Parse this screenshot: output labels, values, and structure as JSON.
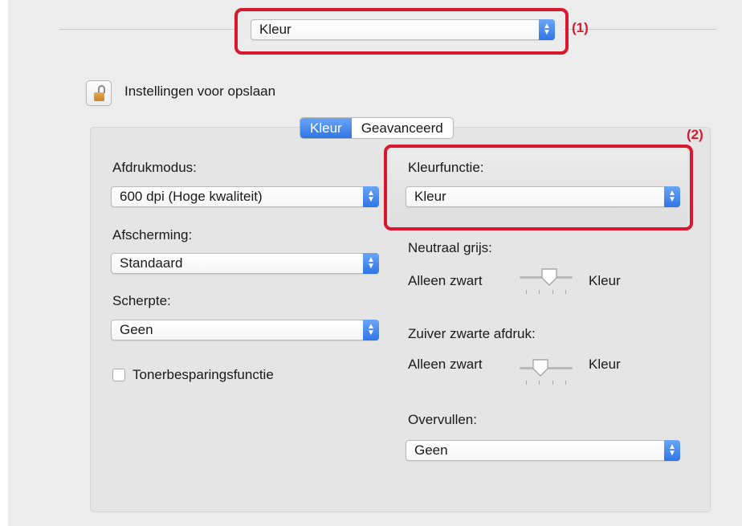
{
  "top_popup": {
    "value": "Kleur"
  },
  "annotations": {
    "one": "(1)",
    "two": "(2)"
  },
  "save_settings": {
    "label": "Instellingen voor opslaan"
  },
  "tabs": [
    {
      "label": "Kleur",
      "active": true
    },
    {
      "label": "Geavanceerd",
      "active": false
    }
  ],
  "left": {
    "print_mode": {
      "label": "Afdrukmodus:",
      "value": "600 dpi (Hoge kwaliteit)"
    },
    "screening": {
      "label": "Afscherming:",
      "value": "Standaard"
    },
    "sharpness": {
      "label": "Scherpte:",
      "value": "Geen"
    },
    "toner_save": {
      "label": "Tonerbesparingsfunctie",
      "checked": false
    }
  },
  "right": {
    "color_mode": {
      "label": "Kleurfunctie:",
      "value": "Kleur"
    },
    "neutral_gray": {
      "label": "Neutraal grijs:",
      "left_label": "Alleen zwart",
      "right_label": "Kleur",
      "level": 0.6
    },
    "pure_black": {
      "label": "Zuiver zwarte afdruk:",
      "left_label": "Alleen zwart",
      "right_label": "Kleur",
      "level": 0.35
    },
    "trapping": {
      "label": "Overvullen:",
      "value": "Geen"
    }
  },
  "colors": {
    "accent": "#2f75e6",
    "highlight": "#d9182f"
  }
}
